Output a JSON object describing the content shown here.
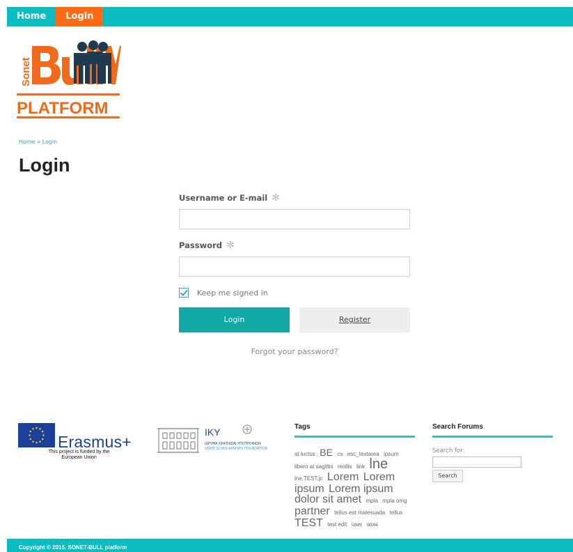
{
  "nav": {
    "home": "Home",
    "login": "Login"
  },
  "logo": {
    "brand": "Sonet",
    "brand_big": "Bull",
    "platform": "PLATFORM"
  },
  "breadcrumb": {
    "home": "Home",
    "sep": "»",
    "current": "Login"
  },
  "page": {
    "title": "Login"
  },
  "form": {
    "username_label": "Username or E-mail",
    "password_label": "Password",
    "required_mark": "✻",
    "username_value": "",
    "password_value": "",
    "keep_signed_in": "Keep me signed in",
    "keep_signed_in_checked": true,
    "login_button": "Login",
    "register_button": "Register",
    "forgot": "Forgot your password?"
  },
  "erasmus": {
    "name": "Erasmus+",
    "note": "This project is funded by the European Union"
  },
  "iky": {
    "name": "IKY",
    "sub_greek": "ΙΔΡΥΜΑ ΚΡΑΤΙΚΩΝ ΥΠΟΤΡΟΦΙΩΝ",
    "sub_english": "STATE SCHOLARSHIPS FOUNDATION"
  },
  "tags": {
    "title": "Tags",
    "items": [
      {
        "text": "at luctus",
        "size": "s"
      },
      {
        "text": "BE",
        "size": "m"
      },
      {
        "text": "cs",
        "size": "s"
      },
      {
        "text": "esc_textarea",
        "size": "s"
      },
      {
        "text": "ipsum",
        "size": "s"
      },
      {
        "text": "libero at sagittis",
        "size": "s"
      },
      {
        "text": "mollis",
        "size": "s"
      },
      {
        "text": "link",
        "size": "s"
      },
      {
        "text": "lne",
        "size": "xl"
      },
      {
        "text": "lne,TEST,jc",
        "size": "s"
      },
      {
        "text": "Lorem",
        "size": "l"
      },
      {
        "text": "Lorem ipsum",
        "size": "l"
      },
      {
        "text": "Lorem ipsum dolor sit amet",
        "size": "l"
      },
      {
        "text": "mpla",
        "size": "s"
      },
      {
        "text": "mpla omg",
        "size": "s"
      },
      {
        "text": "partner",
        "size": "l"
      },
      {
        "text": "tellus est malesuada",
        "size": "s"
      },
      {
        "text": "tellus",
        "size": "s"
      },
      {
        "text": "TEST",
        "size": "l"
      },
      {
        "text": "test edit",
        "size": "s"
      },
      {
        "text": "user",
        "size": "s"
      },
      {
        "text": "wow",
        "size": "s"
      }
    ]
  },
  "forums": {
    "title": "Search Forums",
    "search_label": "Search for:",
    "search_value": "",
    "search_button": "Search"
  },
  "footer": {
    "copyright": "Copyright © 2015. SONET-BULL platform"
  },
  "colors": {
    "teal": "#0bbcc1",
    "orange": "#ff6a13",
    "button_teal": "#12a8a5"
  }
}
